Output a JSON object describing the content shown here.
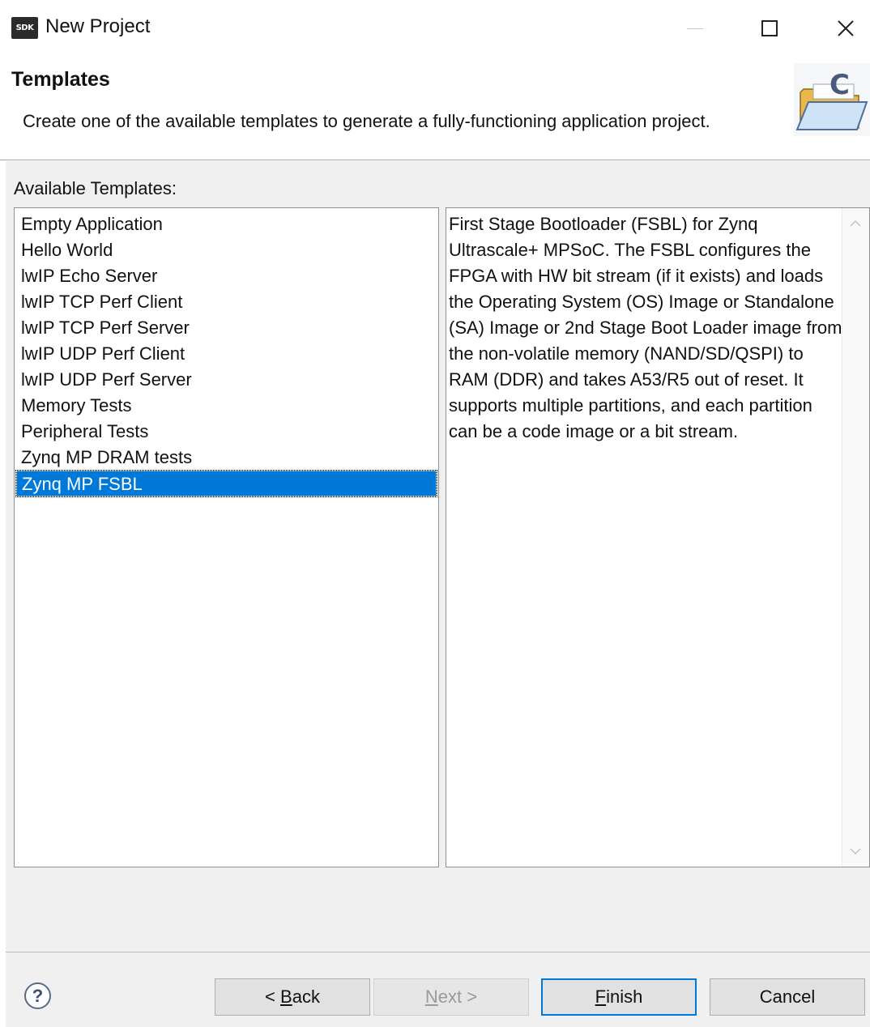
{
  "window": {
    "icon_text": "SDK",
    "title": "New Project"
  },
  "header": {
    "title": "Templates",
    "description": "Create one of the available templates to generate a fully-functioning application project."
  },
  "templates": {
    "label": "Available Templates:",
    "items": [
      "Empty Application",
      "Hello World",
      "lwIP Echo Server",
      "lwIP TCP Perf Client",
      "lwIP TCP Perf Server",
      "lwIP UDP Perf Client",
      "lwIP UDP Perf Server",
      "Memory Tests",
      "Peripheral Tests",
      "Zynq MP DRAM tests",
      "Zynq MP FSBL"
    ],
    "selected_index": 10,
    "description": "First Stage Bootloader (FSBL) for Zynq Ultrascale+ MPSoC. The FSBL configures the FPGA with HW bit stream (if it exists)  and loads the Operating System (OS) Image or Standalone (SA) Image or 2nd Stage Boot Loader image from the  non-volatile memory (NAND/SD/QSPI) to RAM (DDR) and takes A53/R5 out of reset.  It supports multiple partitions,  and each partition can be a code image or a bit stream."
  },
  "buttons": {
    "back_prefix": "< ",
    "back_mnemonic": "B",
    "back_rest": "ack",
    "next_mnemonic": "N",
    "next_rest": "ext >",
    "finish_mnemonic": "F",
    "finish_rest": "inish",
    "cancel": "Cancel"
  },
  "help": {
    "glyph": "?"
  },
  "colors": {
    "selection": "#0078d7",
    "dialog_bg": "#f0f0f0"
  }
}
